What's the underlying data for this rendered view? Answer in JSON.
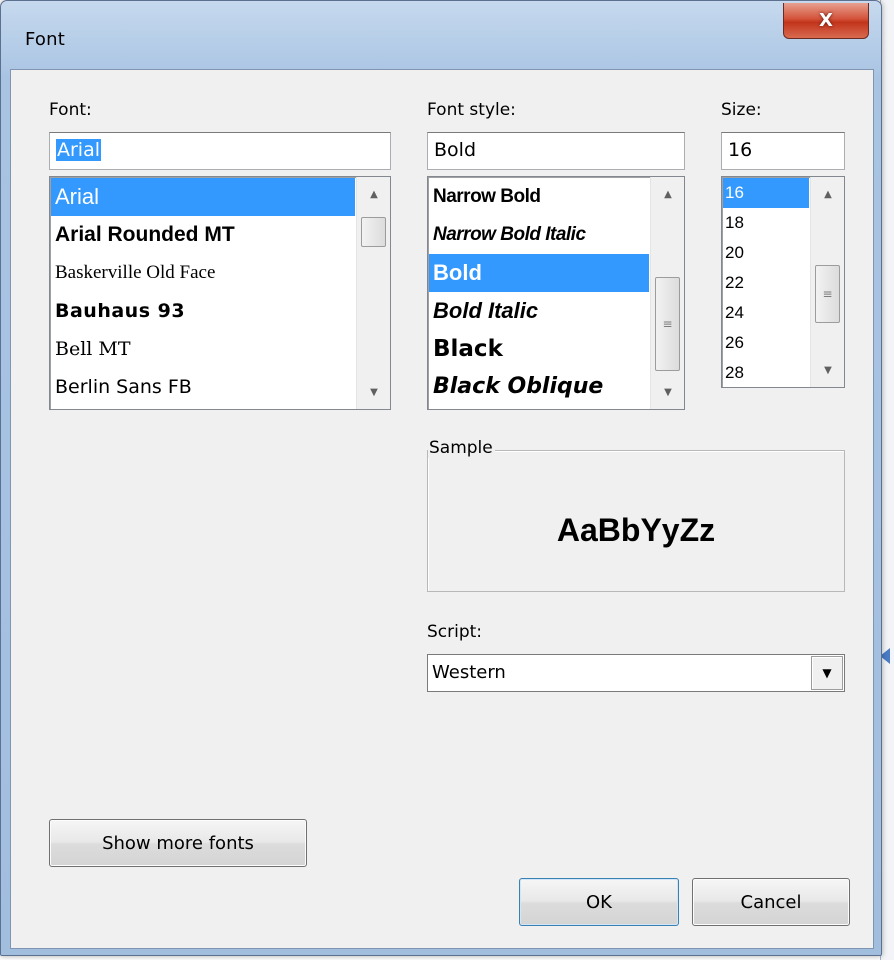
{
  "window": {
    "title": "Font",
    "close_glyph": "X"
  },
  "font_panel": {
    "label": "Font:",
    "current_value": "Arial",
    "items": [
      {
        "label": "Arial",
        "selected": true
      },
      {
        "label": "Arial Rounded MT",
        "selected": false
      },
      {
        "label": "Baskerville Old Face",
        "selected": false
      },
      {
        "label": "Bauhaus 93",
        "selected": false
      },
      {
        "label": "Bell MT",
        "selected": false
      },
      {
        "label": "Berlin Sans FB",
        "selected": false
      }
    ]
  },
  "style_panel": {
    "label": "Font style:",
    "current_value": "Bold",
    "items": [
      {
        "label": "Narrow Bold",
        "selected": false
      },
      {
        "label": "Narrow Bold Italic",
        "selected": false
      },
      {
        "label": "Bold",
        "selected": true
      },
      {
        "label": "Bold Italic",
        "selected": false
      },
      {
        "label": "Black",
        "selected": false
      },
      {
        "label": "Black Oblique",
        "selected": false
      }
    ]
  },
  "size_panel": {
    "label": "Size:",
    "current_value": "16",
    "items": [
      {
        "label": "16",
        "selected": true
      },
      {
        "label": "18",
        "selected": false
      },
      {
        "label": "20",
        "selected": false
      },
      {
        "label": "22",
        "selected": false
      },
      {
        "label": "24",
        "selected": false
      },
      {
        "label": "26",
        "selected": false
      },
      {
        "label": "28",
        "selected": false
      }
    ]
  },
  "sample": {
    "label": "Sample",
    "text": "AaBbYyZz"
  },
  "script": {
    "label": "Script:",
    "selected": "Western"
  },
  "buttons": {
    "show_more": "Show more fonts",
    "ok": "OK",
    "cancel": "Cancel"
  },
  "icons": {
    "scroll_up": "scroll-up-arrow-icon",
    "scroll_down": "scroll-down-arrow-icon",
    "combo_down": "chevron-down-icon"
  },
  "colors": {
    "selection": "#3399ff",
    "close_button": "#c2341c",
    "dialog_background": "#f0f0f0"
  }
}
